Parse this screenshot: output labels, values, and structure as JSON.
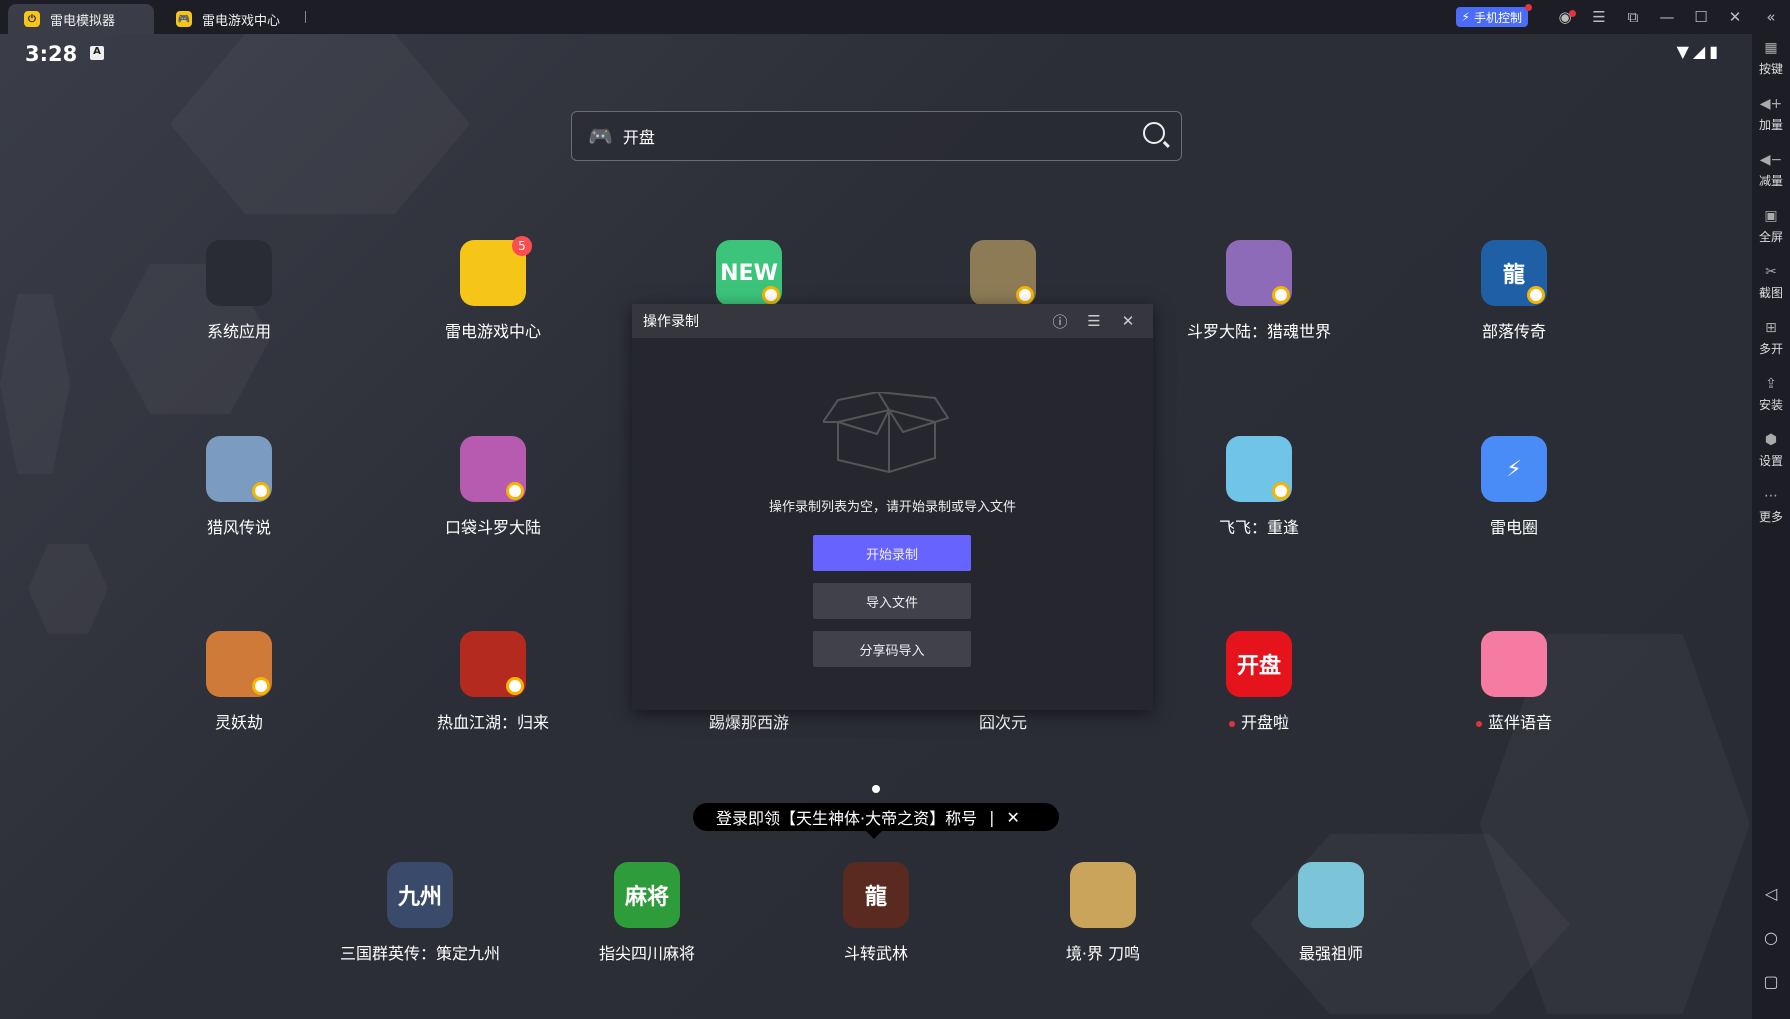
{
  "titlebar": {
    "tabs": [
      {
        "label": "雷电模拟器"
      },
      {
        "label": "雷电游戏中心"
      }
    ],
    "phone_control": "手机控制"
  },
  "status": {
    "time": "3:28"
  },
  "search": {
    "value": "开盘"
  },
  "apps": [
    {
      "label": "系统应用",
      "color": "#2a2c35"
    },
    {
      "label": "雷电游戏中心",
      "color": "#f5c518",
      "badge": "5"
    },
    {
      "label": "",
      "color": "#3cc47a",
      "text": "NEW"
    },
    {
      "label": "",
      "color": "#8c7b55"
    },
    {
      "label": "斗罗大陆：猎魂世界",
      "color": "#8e6bb8"
    },
    {
      "label": "部落传奇",
      "color": "#1f5fa5",
      "text": "龍"
    },
    {
      "label": "猎风传说",
      "color": "#7c9bc0"
    },
    {
      "label": "口袋斗罗大陆",
      "color": "#b65bb0"
    },
    {
      "label": "",
      "color": "#555"
    },
    {
      "label": "",
      "color": "#555"
    },
    {
      "label": "飞飞：重逢",
      "color": "#6fc4e8"
    },
    {
      "label": "雷电圈",
      "color": "#4a8cf7",
      "text": "⚡"
    },
    {
      "label": "灵妖劫",
      "color": "#d07a3a"
    },
    {
      "label": "热血江湖：归来",
      "color": "#b52a1e"
    },
    {
      "label": "踢爆那西游",
      "color": "#555"
    },
    {
      "label": "囧次元",
      "color": "#555"
    },
    {
      "label": "开盘啦",
      "color": "#e4131c",
      "text": "开盘",
      "dot": true
    },
    {
      "label": "蓝伴语音",
      "color": "#f57ba3",
      "dot": true
    }
  ],
  "dialog": {
    "title": "操作录制",
    "empty_text": "操作录制列表为空，请开始录制或导入文件",
    "start": "开始录制",
    "import": "导入文件",
    "share_import": "分享码导入"
  },
  "tooltip": {
    "text": "登录即领【天生神体·大帝之资】称号",
    "separator": "|",
    "close": "✕"
  },
  "dock": [
    {
      "label": "三国群英传：策定九州",
      "color": "#3a4a6a",
      "text": "九州"
    },
    {
      "label": "指尖四川麻将",
      "color": "#2e9c3a",
      "text": "麻将"
    },
    {
      "label": "斗转武林",
      "color": "#5a2a20",
      "text": "龍"
    },
    {
      "label": "境·界 刀鸣",
      "color": "#c9a45a"
    },
    {
      "label": "最强祖师",
      "color": "#7cc4d8"
    }
  ],
  "sidebar": [
    "按键",
    "加量",
    "减量",
    "全屏",
    "截图",
    "多开",
    "安装",
    "设置",
    "更多"
  ]
}
